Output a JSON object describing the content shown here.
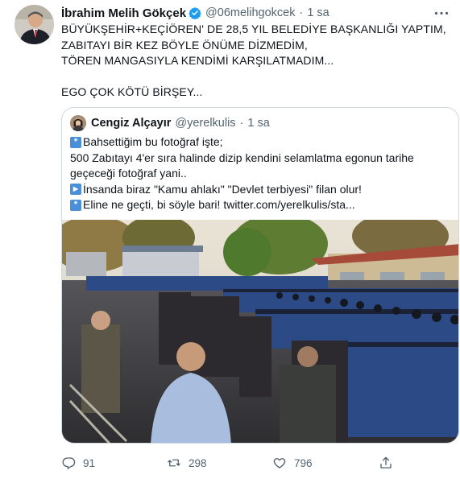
{
  "tweet": {
    "author_name": "İbrahim Melih Gökçek",
    "handle": "@06melihgokcek",
    "separator": "·",
    "time": "1 sa",
    "text": "BÜYÜKŞEHİR+KEÇİÖREN' DE 28,5 YIL BELEDİYE BAŞKANLIĞI YAPTIM,\nZABITAYI BİR KEZ BÖYLE ÖNÜME DİZMEDİM,\nTÖREN MANGASIYLA KENDİMİ KARŞILATMADIM...\n\nEGO ÇOK KÖTÜ BİRŞEY...",
    "icons": {
      "avatar": "profile-photo",
      "verified": "verified-badge-icon",
      "more": "more-icon"
    }
  },
  "quote": {
    "author_name": "Cengiz Alçayır",
    "handle": "@yerelkulis",
    "separator": "·",
    "time": "1 sa",
    "lines": [
      {
        "icon": "*",
        "text": "Bahsettiğim bu fotoğraf işte;"
      },
      {
        "icon": "",
        "text": "500 Zabıtayı 4'er sıra halinde dizip kendini selamlatma egonun tarihe"
      },
      {
        "icon": "",
        "text": "geçeceği fotoğraf yani.."
      },
      {
        "icon": "▶",
        "text": "İnsanda biraz \"Kamu ahlakı\" \"Devlet terbiyesi\" filan olur!"
      },
      {
        "icon": "*",
        "text": "Eline ne geçti, bi söyle bari! twitter.com/yerelkulis/sta..."
      }
    ]
  },
  "actions": {
    "reply_count": "91",
    "retweet_count": "298",
    "like_count": "796",
    "icons": [
      "reply-icon",
      "retweet-icon",
      "like-icon",
      "share-icon"
    ]
  },
  "colors": {
    "verified": "#1d9bf0",
    "secondary_text": "#536471",
    "border": "#cfd9de",
    "uniform_blue": "#2e4f8f"
  }
}
